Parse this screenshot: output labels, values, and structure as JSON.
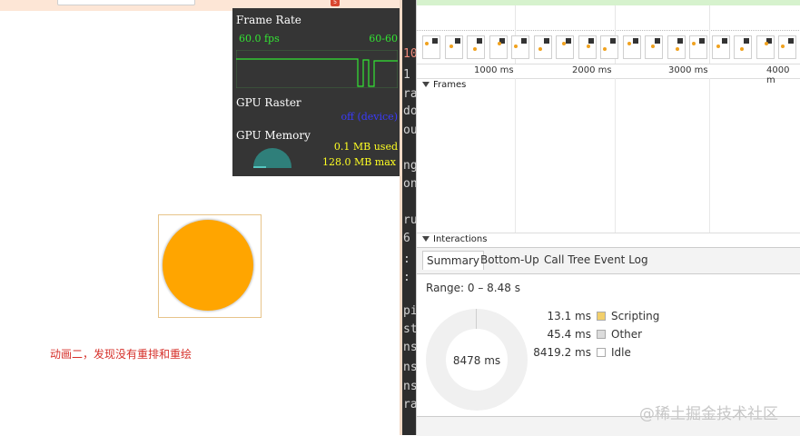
{
  "page": {
    "caption": "动画二，发现没有重排和重绘"
  },
  "fps_meter": {
    "frame_rate_title": "Frame Rate",
    "fps_value": "60.0 fps",
    "fps_range": "60-60",
    "gpu_raster_title": "GPU Raster",
    "gpu_raster_status": "off (device)",
    "gpu_memory_title": "GPU Memory",
    "memory_used": "0.1 MB used",
    "memory_max": "128.0 MB max"
  },
  "code_strip": {
    "lines": [
      "10",
      "1",
      "ra",
      "do",
      "our",
      "ng",
      "on",
      "ru",
      "6",
      ":",
      ":",
      "pi",
      "st",
      "ns",
      "ns",
      "ns",
      "ran"
    ]
  },
  "timeline": {
    "ticks": [
      "1000 ms",
      "2000 ms",
      "3000 ms",
      "4000 m"
    ],
    "frames_label": "Frames",
    "interactions_label": "Interactions"
  },
  "tabs": [
    "Summary",
    "Bottom-Up",
    "Call Tree",
    "Event Log"
  ],
  "summary": {
    "range": "Range: 0 – 8.48 s",
    "total": "8478 ms",
    "rows": [
      {
        "value": "13.1 ms",
        "label": "Scripting",
        "color": "#f2cf6b"
      },
      {
        "value": "45.4 ms",
        "label": "Other",
        "color": "#dcdcdc"
      },
      {
        "value": "8419.2 ms",
        "label": "Idle",
        "color": "#ffffff"
      }
    ]
  },
  "watermark": "@稀土掘金技术社区",
  "colors": {
    "circle": "#ffa500",
    "caption": "#d6302a",
    "fps_green": "#33e633",
    "memory_yellow": "#ffff22"
  }
}
